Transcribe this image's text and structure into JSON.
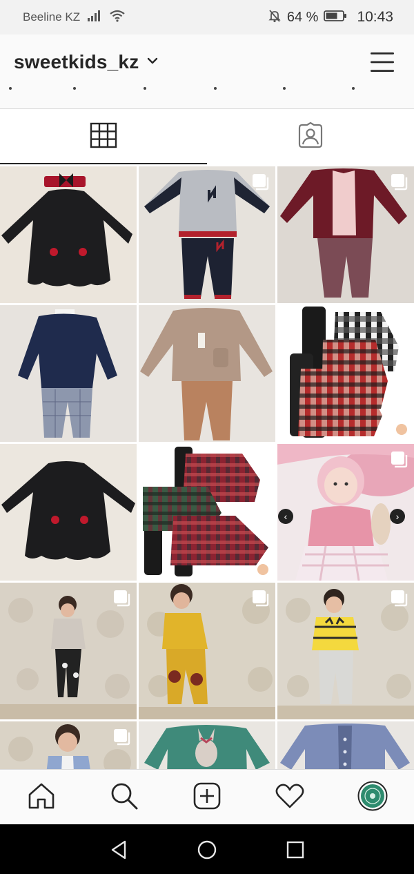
{
  "status_bar": {
    "carrier": "Beeline KZ",
    "battery_percent": "64 %",
    "time": "10:43",
    "icons": [
      "signal-icon",
      "wifi-icon",
      "mute-notification-icon",
      "battery-icon"
    ]
  },
  "profile": {
    "username": "sweetkids_kz",
    "username_icon": "chevron-down-icon",
    "menu_icon": "hamburger-menu-icon"
  },
  "tabs": [
    {
      "name": "posts-grid",
      "icon": "grid-icon",
      "active": true
    },
    {
      "name": "tagged",
      "icon": "tagged-user-icon",
      "active": false
    }
  ],
  "posts": [
    {
      "subject": "black-dress-with-bow",
      "multi": false
    },
    {
      "subject": "varsity-jacket-set",
      "multi": true
    },
    {
      "subject": "burgundy-cardigan-set",
      "multi": true
    },
    {
      "subject": "navy-blazer-set",
      "multi": false
    },
    {
      "subject": "beige-blazer-set",
      "multi": false
    },
    {
      "subject": "plaid-shirts-set",
      "multi": true
    },
    {
      "subject": "black-dress",
      "multi": false
    },
    {
      "subject": "plaid-dress-set",
      "multi": true
    },
    {
      "subject": "baby-pink-outfit",
      "multi": true
    },
    {
      "subject": "toddler-grey-sweater",
      "multi": true
    },
    {
      "subject": "toddler-yellow-sweater",
      "multi": true
    },
    {
      "subject": "toddler-yellow-cat-sweater",
      "multi": true
    },
    {
      "subject": "toddler-blue-cardigan",
      "multi": true
    },
    {
      "subject": "green-bunny-sweater",
      "multi": false
    },
    {
      "subject": "blue-cardigan",
      "multi": false
    }
  ],
  "bottom_nav": [
    {
      "name": "home",
      "icon": "home-icon"
    },
    {
      "name": "search",
      "icon": "search-icon"
    },
    {
      "name": "new-post",
      "icon": "add-post-icon"
    },
    {
      "name": "activity",
      "icon": "heart-icon"
    },
    {
      "name": "profile",
      "icon": "profile-avatar-icon"
    }
  ],
  "colors": {
    "background": "#ffffff",
    "status_bar": "#f2f2f2",
    "divider": "#dbdbdb",
    "text": "#262626"
  }
}
